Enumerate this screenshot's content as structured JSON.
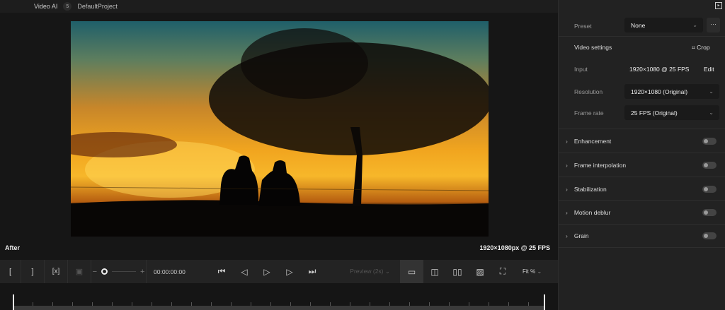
{
  "topbar": {
    "app": "Video AI",
    "count": "5",
    "project": "DefaultProject"
  },
  "viewer": {
    "label": "After",
    "info": "1920×1080px @ 25 FPS"
  },
  "controls": {
    "mark_in": "[",
    "mark_out": "]",
    "clear": "[x]",
    "zoom_minus": "−",
    "zoom_plus": "+",
    "timecode": "00:00:00:00",
    "preview": "Preview (2s)",
    "fit": "Fit %"
  },
  "panel": {
    "preset_label": "Preset",
    "preset_value": "None",
    "more": "···",
    "video_settings": "Video settings",
    "crop": "Crop",
    "input_label": "Input",
    "input_value": "1920×1080 @ 25 FPS",
    "edit": "Edit",
    "resolution_label": "Resolution",
    "resolution_value": "1920×1080 (Original)",
    "framerate_label": "Frame rate",
    "framerate_value": "25 FPS (Original)",
    "sections": [
      {
        "label": "Enhancement",
        "enabled": false
      },
      {
        "label": "Frame interpolation",
        "enabled": false
      },
      {
        "label": "Stabilization",
        "enabled": false
      },
      {
        "label": "Motion deblur",
        "enabled": false
      },
      {
        "label": "Grain",
        "enabled": false
      }
    ]
  }
}
